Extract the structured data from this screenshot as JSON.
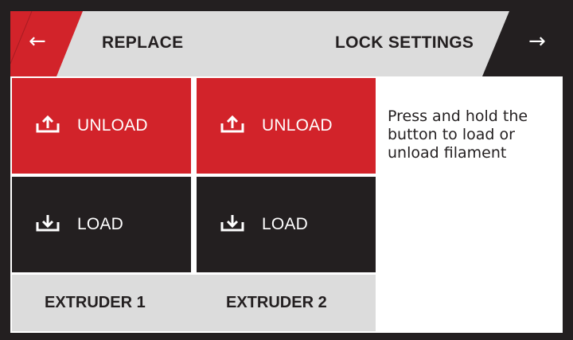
{
  "header": {
    "back_label": "←",
    "title": "REPLACE",
    "lock_settings_label": "LOCK SETTINGS",
    "forward_label": "→"
  },
  "extruders": [
    {
      "unload_label": "UNLOAD",
      "load_label": "LOAD",
      "name": "EXTRUDER 1"
    },
    {
      "unload_label": "UNLOAD",
      "load_label": "LOAD",
      "name": "EXTRUDER 2"
    }
  ],
  "info_text": "Press and hold the button to load or unload filament",
  "icons": {
    "unload": "upload-tray-icon",
    "load": "download-tray-icon",
    "back": "arrow-left-icon",
    "forward": "arrow-right-icon"
  },
  "colors": {
    "accent_red": "#d2232a",
    "dark": "#231f20",
    "light_gray": "#dcdcdc",
    "white": "#ffffff"
  }
}
